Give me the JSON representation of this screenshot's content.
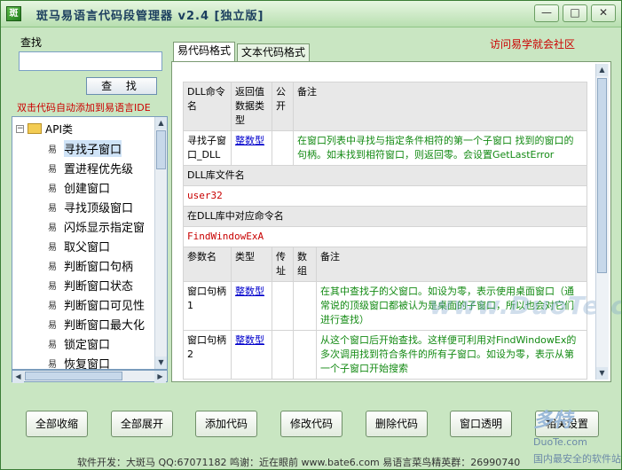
{
  "window": {
    "app_icon_text": "斑",
    "title": "斑马易语言代码段管理器  v2.4  [独立版]",
    "controls": {
      "minimize": "—",
      "maximize": "□",
      "close": "✕"
    }
  },
  "left": {
    "search_label": "查找",
    "search_value": "",
    "search_button": "查 找",
    "hint": "双击代码自动添加到易语言IDE",
    "tree": {
      "root_label": "API类",
      "root_expander": "−",
      "items": [
        {
          "label": "寻找子窗口",
          "selected": true
        },
        {
          "label": "置进程优先级"
        },
        {
          "label": "创建窗口"
        },
        {
          "label": "寻找顶级窗口"
        },
        {
          "label": "闪烁显示指定窗"
        },
        {
          "label": "取父窗口"
        },
        {
          "label": "判断窗口句柄"
        },
        {
          "label": "判断窗口状态"
        },
        {
          "label": "判断窗口可见性"
        },
        {
          "label": "判断窗口最大化"
        },
        {
          "label": "锁定窗口"
        },
        {
          "label": "恢复窗口"
        }
      ],
      "item_icon": "易"
    }
  },
  "tabs": [
    {
      "label": "易代码格式",
      "active": true
    },
    {
      "label": "文本代码格式",
      "active": false
    }
  ],
  "visit_link": "访问易学就会社区",
  "doc": {
    "header": {
      "c1": "DLL命令名",
      "c2": "返回值数据类型",
      "c3": "公开",
      "c4": "备注"
    },
    "row": {
      "name": "寻找子窗口_DLL",
      "type": "整数型",
      "public": "",
      "note": "在窗口列表中寻找与指定条件相符的第一个子窗口 找到的窗口的句柄。如未找到相符窗口，则返回零。会设置GetLastError"
    },
    "lib_label": "DLL库文件名",
    "lib_value": "user32",
    "cmd_label": "在DLL库中对应命令名",
    "cmd_value": "FindWindowExA",
    "param_header": {
      "c1": "参数名",
      "c2": "类型",
      "c3": "传址",
      "c4": "数组",
      "c5": "备注"
    },
    "params": [
      {
        "name": "窗口句柄1",
        "type": "整数型",
        "byref": "",
        "array": "",
        "note": "在其中查找子的父窗口。如设为零，表示使用桌面窗口（通常说的顶级窗口都被认为是桌面的子窗口，所以也会对它们进行查找）"
      },
      {
        "name": "窗口句柄2",
        "type": "整数型",
        "byref": "",
        "array": "",
        "note": "从这个窗口后开始查找。这样便可利用对FindWindowEx的多次调用找到符合条件的所有子窗口。如设为零，表示从第一个子窗口开始搜索"
      }
    ]
  },
  "buttons": {
    "collapse_all": "全部收缩",
    "expand_all": "全部展开",
    "add_code": "添加代码",
    "edit_code": "修改代码",
    "delete_code": "删除代码",
    "window_transparent": "窗口透明",
    "settings": "相关设置"
  },
  "footer": "软件开发：大斑马   QQ:67071182   鸣谢：近在眼前   www.bate6.com  易语言菜鸟精英群：26990740",
  "watermark": "www.DuoTe.com",
  "brand": {
    "logo": "多特",
    "sub": "DuoTe.com",
    "slogan": "国内最安全的软件站"
  }
}
